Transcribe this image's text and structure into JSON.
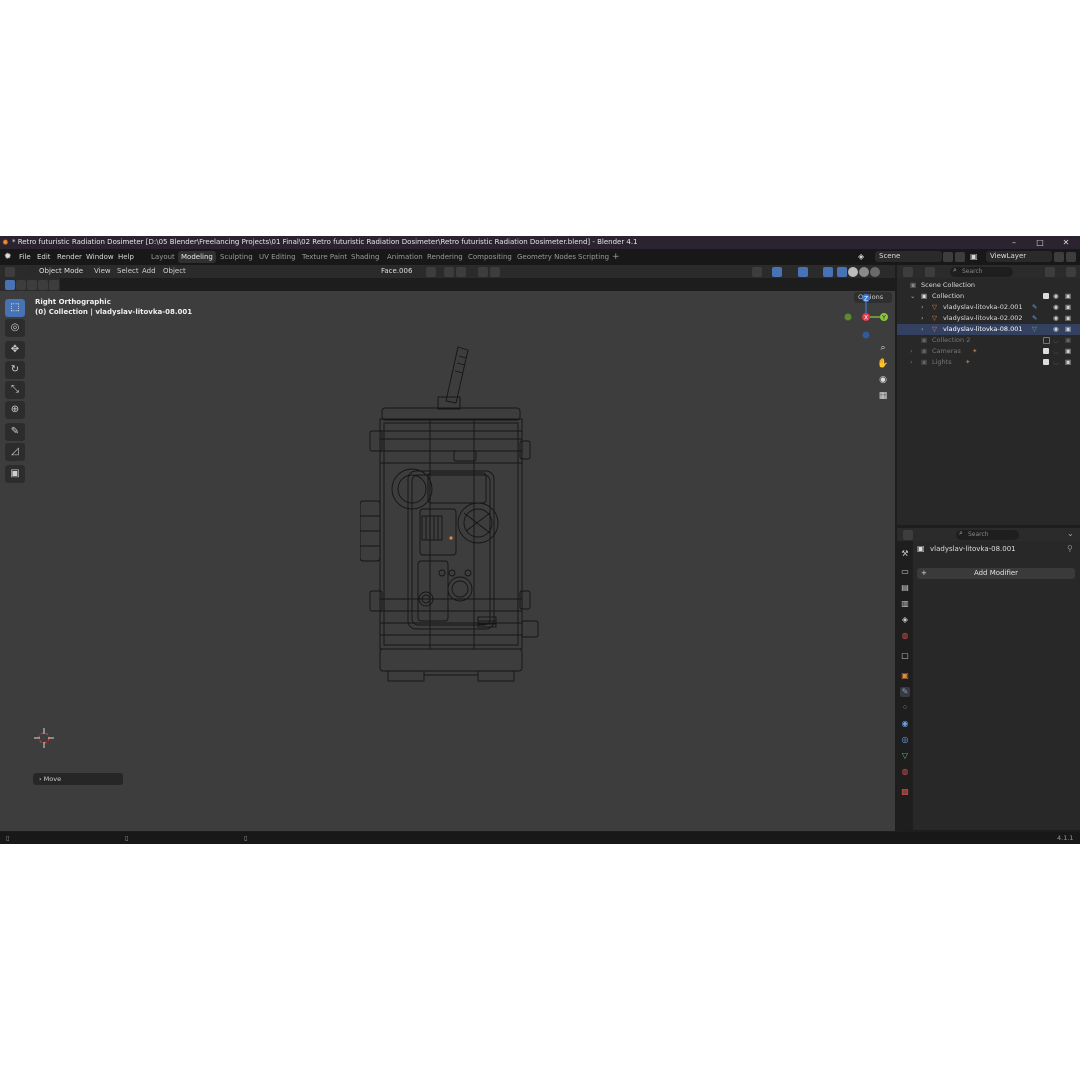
{
  "window": {
    "title": "* Retro futuristic Radiation Dosimeter [D:\\05 Blender\\Freelancing Projects\\01 Final\\02 Retro futuristic Radiation Dosimeter\\Retro futuristic Radiation Dosimeter.blend] - Blender 4.1",
    "minimize": "–",
    "maximize": "□",
    "close": "✕"
  },
  "menu": [
    "File",
    "Edit",
    "Render",
    "Window",
    "Help"
  ],
  "workspaces": [
    "Layout",
    "Modeling",
    "Sculpting",
    "UV Editing",
    "Texture Paint",
    "Shading",
    "Animation",
    "Rendering",
    "Compositing",
    "Geometry Nodes",
    "Scripting"
  ],
  "add_workspace": "+",
  "active_workspace": "Modeling",
  "scene": {
    "name": "Scene",
    "view_layer": "ViewLayer"
  },
  "viewport_header": {
    "mode": "Object Mode",
    "menus": [
      "View",
      "Select",
      "Add",
      "Object"
    ],
    "orientation": "Face.006",
    "options": "Options"
  },
  "viewport": {
    "view_name": "Right Orthographic",
    "context": "(0) Collection | vladyslav-litovka-08.001",
    "gizmo_axes": {
      "z": "Z",
      "y": "Y",
      "x": "X"
    },
    "last_operator": "Move"
  },
  "outliner": {
    "search_placeholder": "Search",
    "scene_collection": "Scene Collection",
    "rows": [
      {
        "label": "Collection"
      },
      {
        "label": "vladyslav-litovka-02.001"
      },
      {
        "label": "vladyslav-litovka-02.002"
      },
      {
        "label": "vladyslav-litovka-08.001"
      },
      {
        "label": "Collection 2"
      },
      {
        "label": "Cameras"
      },
      {
        "label": "Lights"
      }
    ]
  },
  "properties": {
    "search_placeholder": "Search",
    "object_name": "vladyslav-litovka-08.001",
    "add_modifier": "Add Modifier"
  },
  "status": {
    "version": "4.1.1"
  },
  "colors": {
    "accent": "#4772b3",
    "viewport_bg": "#3d3d3d",
    "selection_orange": "#e08a3a"
  }
}
